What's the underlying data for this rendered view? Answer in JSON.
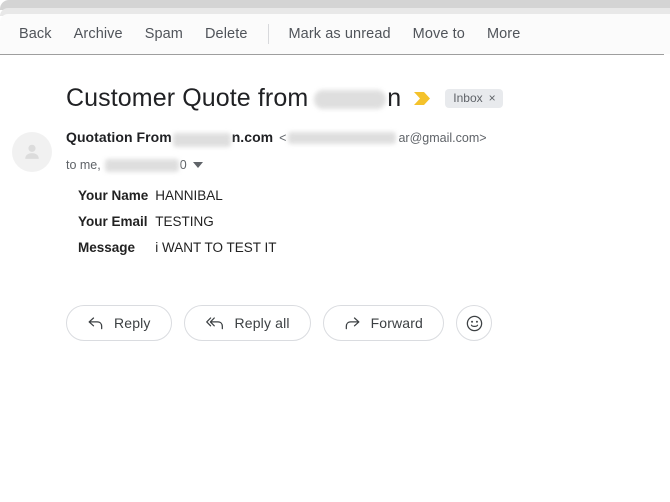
{
  "toolbar": {
    "items": [
      {
        "label": "Back",
        "name": "toolbar-back"
      },
      {
        "label": "Archive",
        "name": "toolbar-archive"
      },
      {
        "label": "Spam",
        "name": "toolbar-spam"
      },
      {
        "label": "Delete",
        "name": "toolbar-delete"
      },
      {
        "label": "Mark as unread",
        "name": "toolbar-mark-as-unread"
      },
      {
        "label": "Move to",
        "name": "toolbar-move-to"
      },
      {
        "label": "More",
        "name": "toolbar-more"
      }
    ]
  },
  "subject": {
    "text_before": "Customer Quote from",
    "text_after": "n",
    "label_chip": "Inbox",
    "label_chip_remove": "×"
  },
  "sender": {
    "name_before": "Quotation From",
    "name_after": "n.com",
    "email_open": "<",
    "email_suffix": "ar@gmail.com>",
    "to_prefix": "to me,",
    "to_suffix": "0"
  },
  "body": {
    "rows": [
      {
        "label": "Your Name",
        "value": "HANNIBAL"
      },
      {
        "label": "Your Email",
        "value": "TESTING"
      },
      {
        "label": "Message",
        "value": "i WANT TO TEST IT"
      }
    ]
  },
  "actions": {
    "reply": "Reply",
    "reply_all": "Reply all",
    "forward": "Forward"
  },
  "colors": {
    "important_marker": "#f4c22b",
    "chip_background": "#e8eaed",
    "toolbar_text": "#50545a",
    "subject_text": "#202124"
  },
  "icons": {
    "important": "important-marker-icon",
    "reply": "reply-arrow-icon",
    "reply_all": "reply-all-arrow-icon",
    "forward": "forward-arrow-icon",
    "emoji": "smiley-face-icon",
    "avatar": "person-avatar-icon",
    "recipients_caret": "chevron-down-icon"
  }
}
